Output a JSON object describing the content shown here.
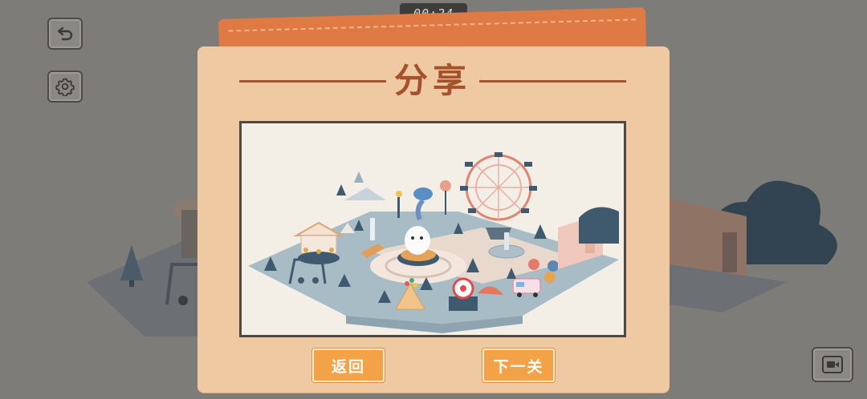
{
  "timer": "00:24",
  "dialog": {
    "title": "分享",
    "back_label": "返回",
    "next_label": "下一关"
  },
  "hud": {
    "undo_icon": "undo-arrow-icon",
    "settings_icon": "gear-icon",
    "camera_icon": "video-camera-icon"
  },
  "colors": {
    "accent": "#f4a247",
    "card": "#efc9a2",
    "title": "#a5512b",
    "cover": "#e07a45"
  }
}
